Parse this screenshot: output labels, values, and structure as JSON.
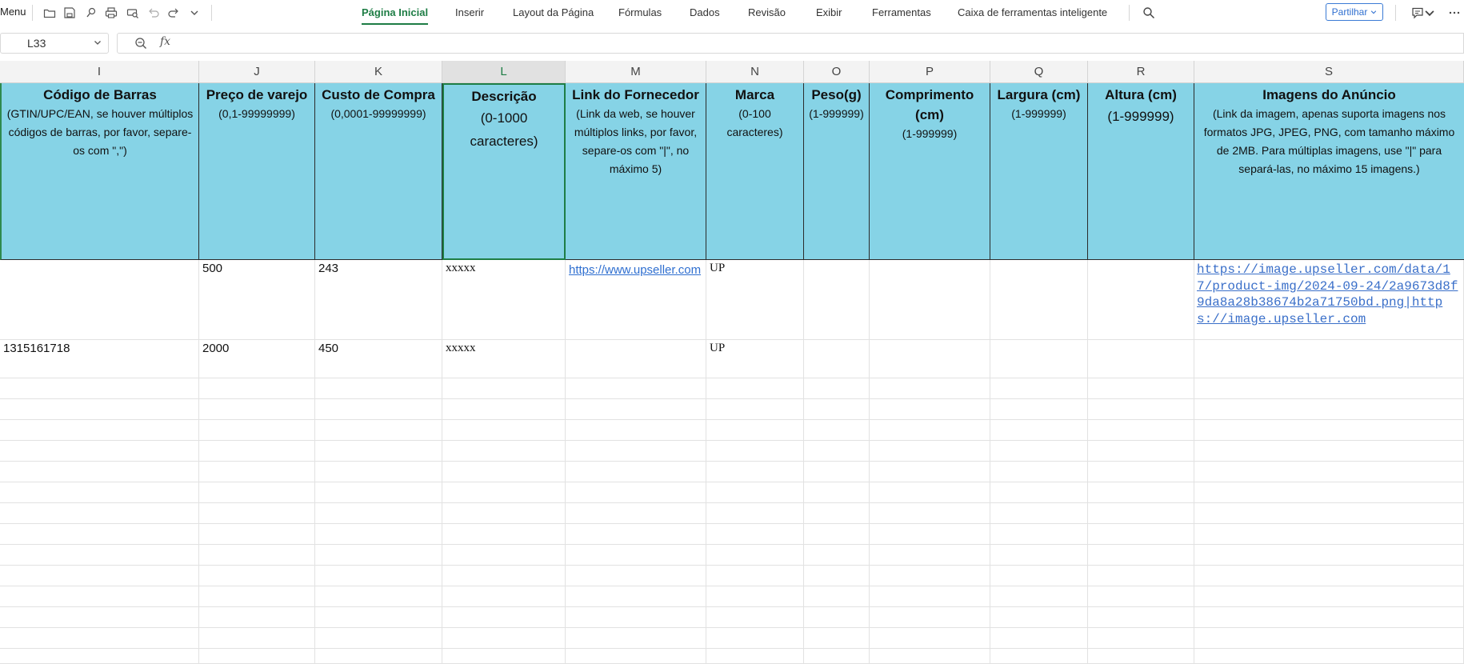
{
  "toolbar": {
    "menu_label": "Menu",
    "tabs": [
      {
        "label": "Página Inicial",
        "active": true
      },
      {
        "label": "Inserir"
      },
      {
        "label": "Layout da Página"
      },
      {
        "label": "Fórmulas"
      },
      {
        "label": "Dados"
      },
      {
        "label": "Revisão"
      },
      {
        "label": "Exibir"
      },
      {
        "label": "Ferramentas"
      },
      {
        "label": "Caixa de ferramentas inteligente"
      }
    ],
    "share_label": "Partilhar"
  },
  "formula_bar": {
    "cell_ref": "L33",
    "fx_label": "fx",
    "value": ""
  },
  "columns": [
    {
      "letter": "I",
      "title": "Código de Barras",
      "subtitle": "(GTIN/UPC/EAN, se houver múltiplos códigos de barras, por favor, separe-os com \",\")"
    },
    {
      "letter": "J",
      "title": "Preço de varejo",
      "subtitle": "(0,1-99999999)"
    },
    {
      "letter": "K",
      "title": "Custo de Compra",
      "subtitle": "(0,0001-99999999)"
    },
    {
      "letter": "L",
      "title": "Descrição",
      "subtitle": "(0-1000 caracteres)",
      "selected": true
    },
    {
      "letter": "M",
      "title": "Link do Fornecedor",
      "subtitle": "(Link da web, se houver múltiplos links, por favor, separe-os com \"|\", no máximo 5)"
    },
    {
      "letter": "N",
      "title": "Marca",
      "subtitle": "(0-100 caracteres)"
    },
    {
      "letter": "O",
      "title": "Peso(g)",
      "subtitle": "(1-999999)"
    },
    {
      "letter": "P",
      "title": "Comprimento (cm)",
      "subtitle": "(1-999999)"
    },
    {
      "letter": "Q",
      "title": "Largura (cm)",
      "subtitle": "(1-999999)"
    },
    {
      "letter": "R",
      "title": "Altura (cm)",
      "subtitle": "(1-999999)"
    },
    {
      "letter": "S",
      "title": "Imagens do Anúncio",
      "subtitle": "(Link da imagem, apenas suporta imagens nos formatos JPG, JPEG, PNG, com tamanho máximo de 2MB. Para múltiplas imagens, use \"|\" para separá-las, no máximo 15 imagens.)"
    }
  ],
  "rows": [
    {
      "I": "",
      "J": "500",
      "K": "243",
      "L": "xxxxx",
      "M": "https://www.upseller.com",
      "N": "UP",
      "O": "",
      "P": "",
      "Q": "",
      "R": "",
      "S": "https://image.upseller.com/data/17/product-img/2024-09-24/2a9673d8f9da8a28b38674b2a71750bd.png|https://image.upseller.com"
    },
    {
      "I": "1315161718",
      "J": "2000",
      "K": "450",
      "L": "xxxxx",
      "M": "",
      "N": "UP",
      "O": "",
      "P": "",
      "Q": "",
      "R": "",
      "S": ""
    }
  ]
}
